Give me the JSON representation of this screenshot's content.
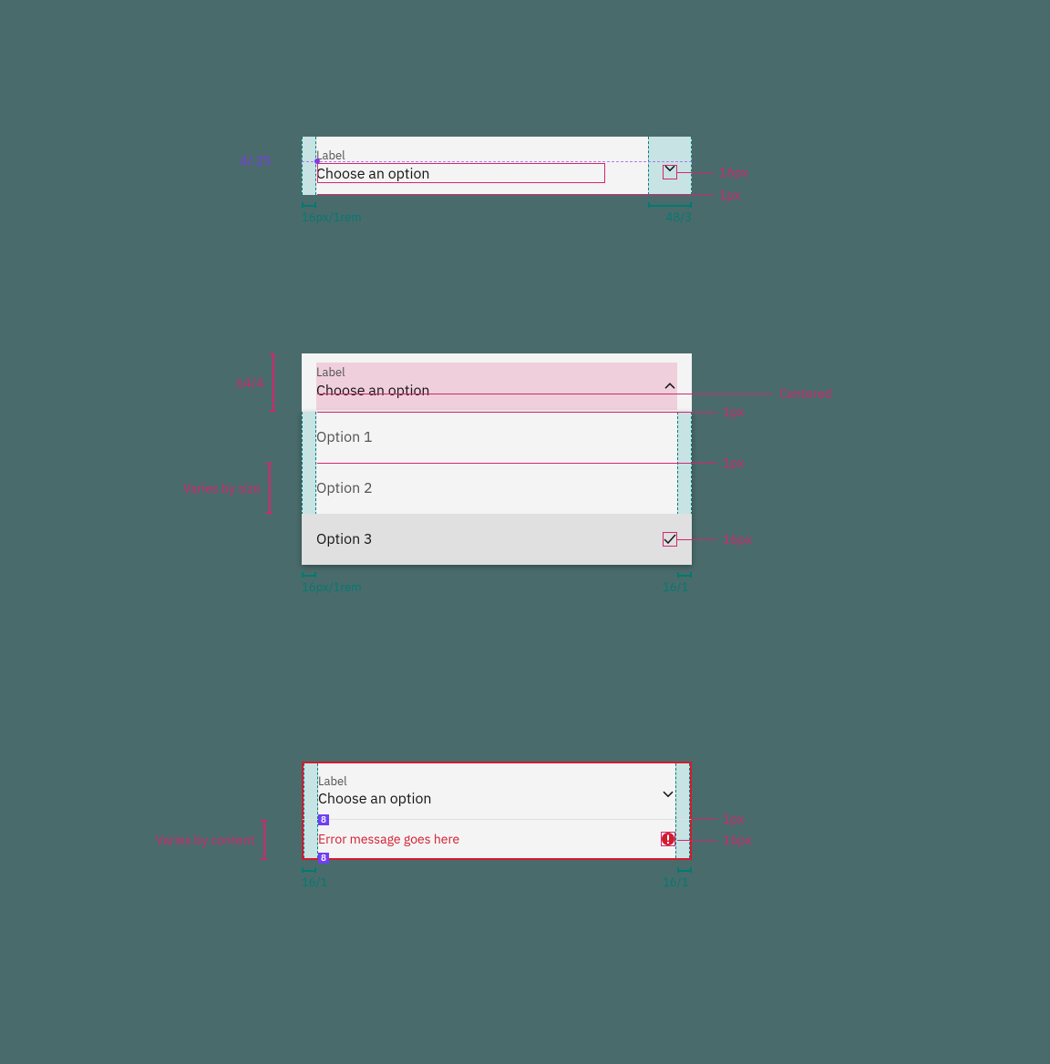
{
  "spec1": {
    "label": "Label",
    "value": "Choose an option",
    "purple_text": "4/.25",
    "callout_icon": "16px",
    "callout_rule": "1px",
    "meas_left": "16px/1rem",
    "meas_right": "48/3"
  },
  "spec2": {
    "label": "Label",
    "value": "Choose an option",
    "option1": "Option 1",
    "option2": "Option 2",
    "option3": "Option 3",
    "meas_header": "64/4",
    "meas_optnote": "Varies by size",
    "callout_centered": "Centered",
    "callout_1px_a": "1px",
    "callout_1px_b": "1px",
    "callout_check": "16px",
    "meas_left": "16px/1rem",
    "meas_right": "16/1"
  },
  "spec3": {
    "label": "Label",
    "value": "Choose an option",
    "error": "Error message goes here",
    "eight": "8",
    "meas_content": "Varies by content",
    "callout_rule": "1px",
    "callout_icon": "16px",
    "meas_left": "16/1",
    "meas_right": "16/1"
  }
}
